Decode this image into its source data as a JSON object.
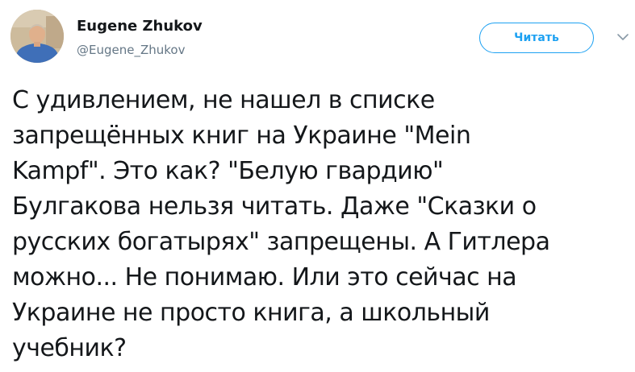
{
  "author": {
    "display_name": "Eugene Zhukov",
    "handle": "@Eugene_Zhukov",
    "avatar_icon": "user-photo-avatar"
  },
  "follow_button": {
    "label": "Читать",
    "color": "#1da1f2"
  },
  "menu": {
    "icon": "chevron-down-icon"
  },
  "tweet": {
    "lines": [
      "С удивлением, не нашел в списке",
      "запрещённых книг на Украине \"Mein",
      "Kampf\". Это как? \"Белую гвардию\"",
      "Булгакова нельзя читать. Даже \"Сказки о",
      "русских богатырях\" запрещены. А Гитлера",
      "можно... Не понимаю. Или это сейчас на",
      "Украине не просто книга, а школьный",
      "учебник?"
    ]
  },
  "colors": {
    "text": "#14171a",
    "secondary": "#657786",
    "accent": "#1da1f2"
  }
}
